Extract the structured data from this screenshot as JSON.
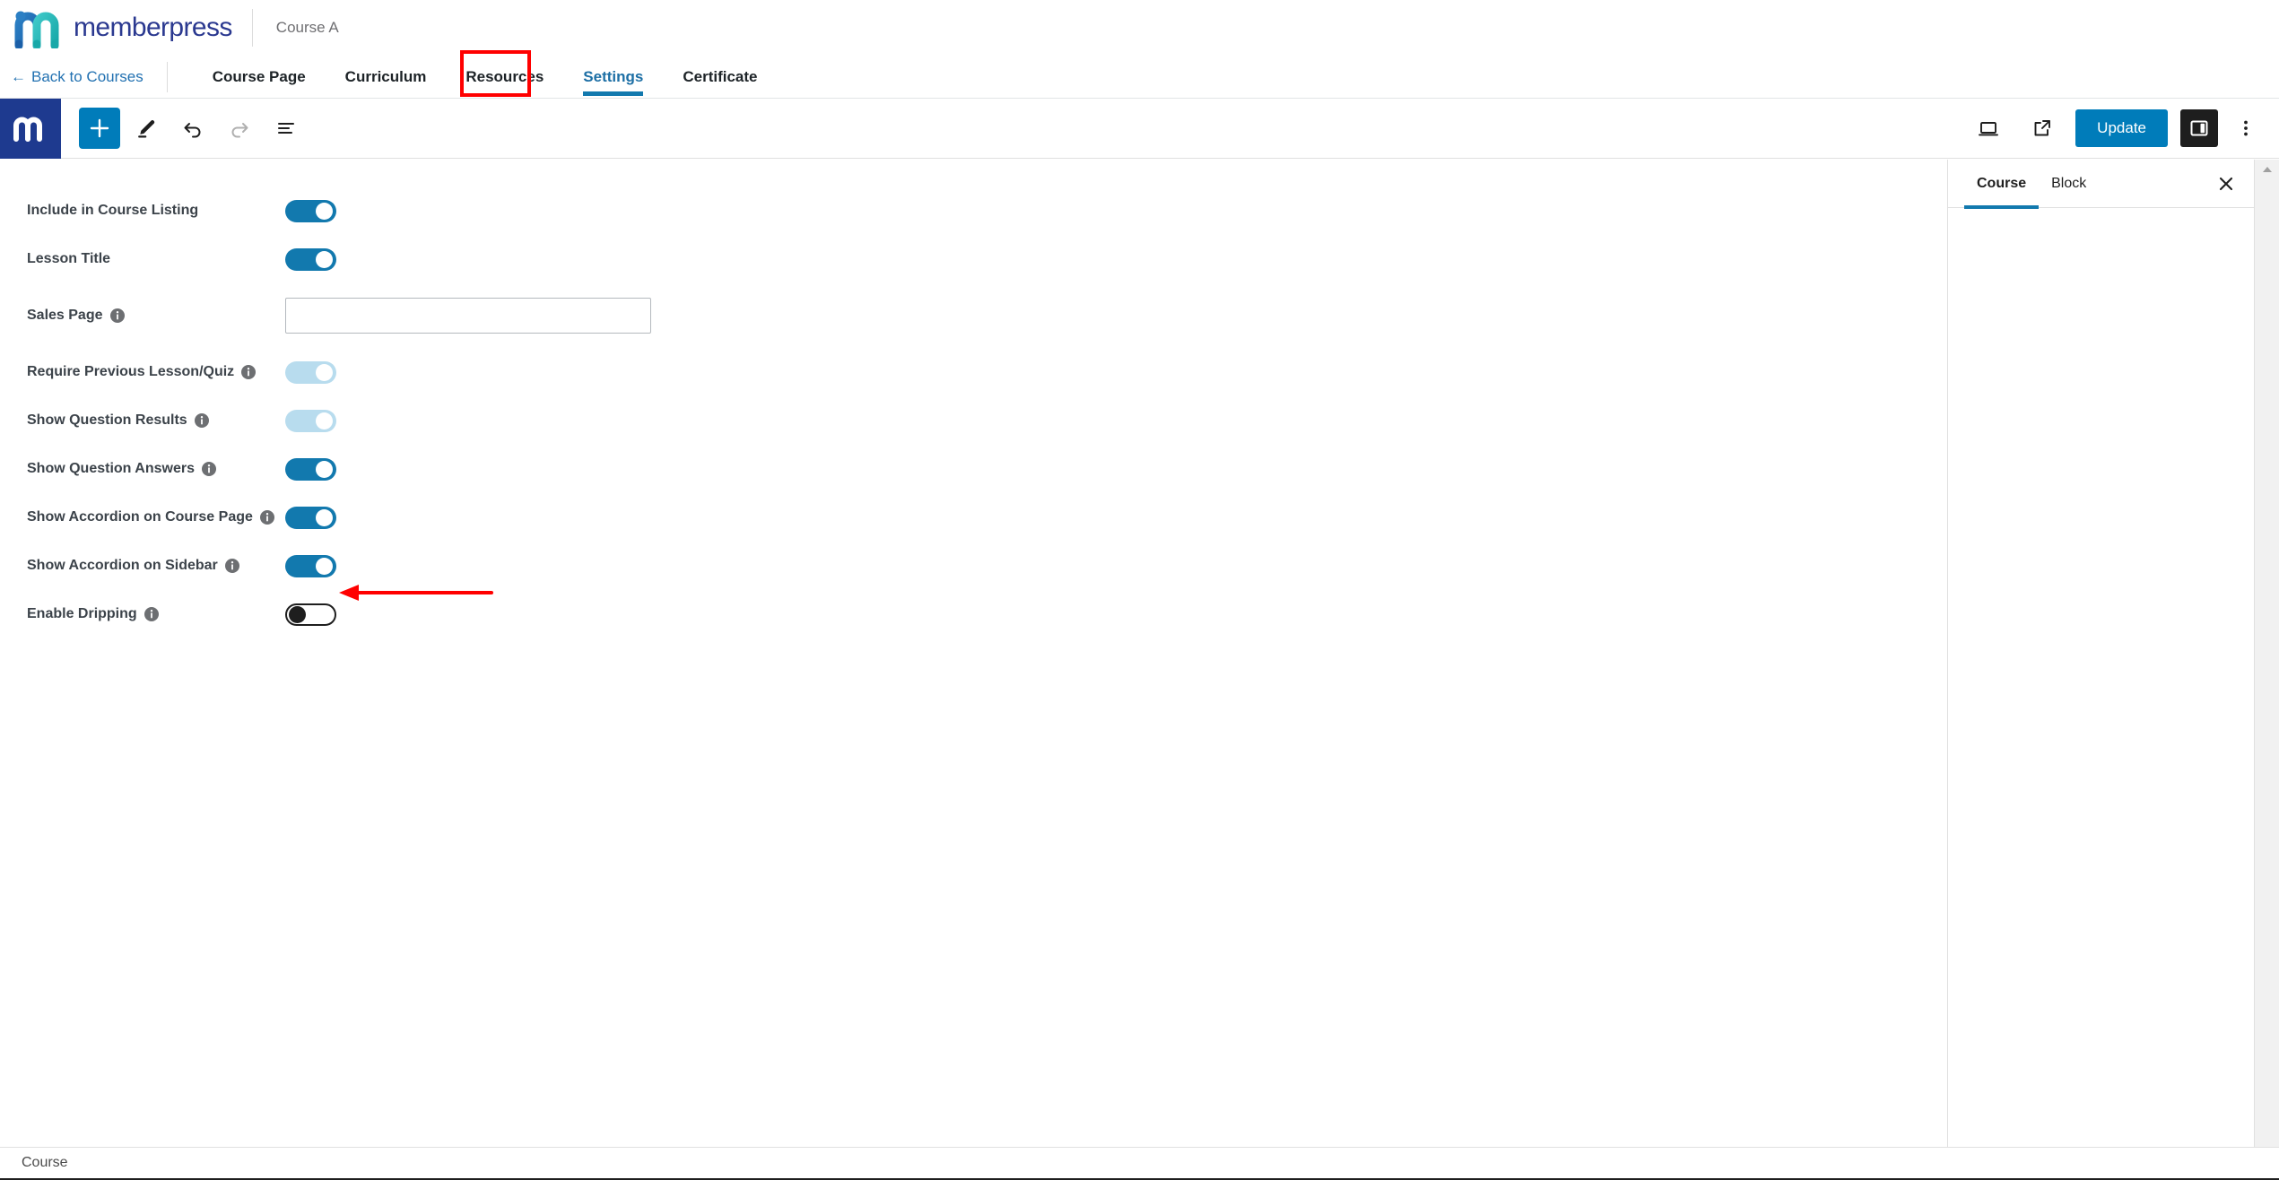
{
  "brand": {
    "name": "memberpress",
    "logo_icon": "memberpress-m-logo",
    "course_name": "Course A"
  },
  "course_nav": {
    "back_label": "Back to Courses",
    "back_icon": "arrow-left-icon",
    "tabs": [
      {
        "label": "Course Page",
        "active": false
      },
      {
        "label": "Curriculum",
        "active": false
      },
      {
        "label": "Resources",
        "active": false
      },
      {
        "label": "Settings",
        "active": true
      },
      {
        "label": "Certificate",
        "active": false
      }
    ],
    "highlight_color": "#ff0000",
    "active_color": "#1279ae"
  },
  "editor_toolbar": {
    "logo_icon": "memberpress-m-mark",
    "logo_bg": "#1e3a8f",
    "left_tools": [
      {
        "name": "add-block-button",
        "icon": "plus-icon",
        "label": "Add block",
        "primary": true
      },
      {
        "name": "tools-button",
        "icon": "pencil-icon",
        "label": "Tools"
      },
      {
        "name": "undo-button",
        "icon": "undo-icon",
        "label": "Undo"
      },
      {
        "name": "redo-button",
        "icon": "redo-icon",
        "label": "Redo",
        "disabled": true
      },
      {
        "name": "list-view-button",
        "icon": "list-view-icon",
        "label": "List View"
      }
    ],
    "right_tools": [
      {
        "name": "preview-button",
        "icon": "desktop-icon",
        "label": "Preview"
      },
      {
        "name": "view-post-button",
        "icon": "external-link-icon",
        "label": "View"
      }
    ],
    "update_label": "Update",
    "update_color": "#007cba",
    "settings_toggle_icon": "sidebar-panel-icon",
    "options_icon": "three-dots-vertical-icon"
  },
  "settings": {
    "rows": [
      {
        "label": "Include in Course Listing",
        "info": false,
        "control": "toggle",
        "state": "on"
      },
      {
        "label": "Lesson Title",
        "info": false,
        "control": "toggle",
        "state": "on"
      },
      {
        "label": "Sales Page",
        "info": true,
        "control": "text",
        "value": "",
        "placeholder": ""
      },
      {
        "label": "Require Previous Lesson/Quiz",
        "info": true,
        "control": "toggle",
        "state": "dim"
      },
      {
        "label": "Show Question Results",
        "info": true,
        "control": "toggle",
        "state": "dim"
      },
      {
        "label": "Show Question Answers",
        "info": true,
        "control": "toggle",
        "state": "on"
      },
      {
        "label": "Show Accordion on Course Page",
        "info": true,
        "control": "toggle",
        "state": "on"
      },
      {
        "label": "Show Accordion on Sidebar",
        "info": true,
        "control": "toggle",
        "state": "on"
      },
      {
        "label": "Enable Dripping",
        "info": true,
        "control": "toggle",
        "state": "off"
      }
    ],
    "toggle_on_color": "#1279ae",
    "toggle_dim_color": "#b8dcee",
    "info_icon": "info-circle-icon"
  },
  "sidebar_panel": {
    "tabs": [
      {
        "label": "Course",
        "active": true
      },
      {
        "label": "Block",
        "active": false
      }
    ],
    "close_icon": "close-icon",
    "active_underline_color": "#1279ae"
  },
  "statusbar": {
    "breadcrumb": "Course"
  },
  "annotations": {
    "arrow_color": "#ff0000",
    "arrow_target": "Enable Dripping toggle",
    "box_target": "Settings tab"
  }
}
